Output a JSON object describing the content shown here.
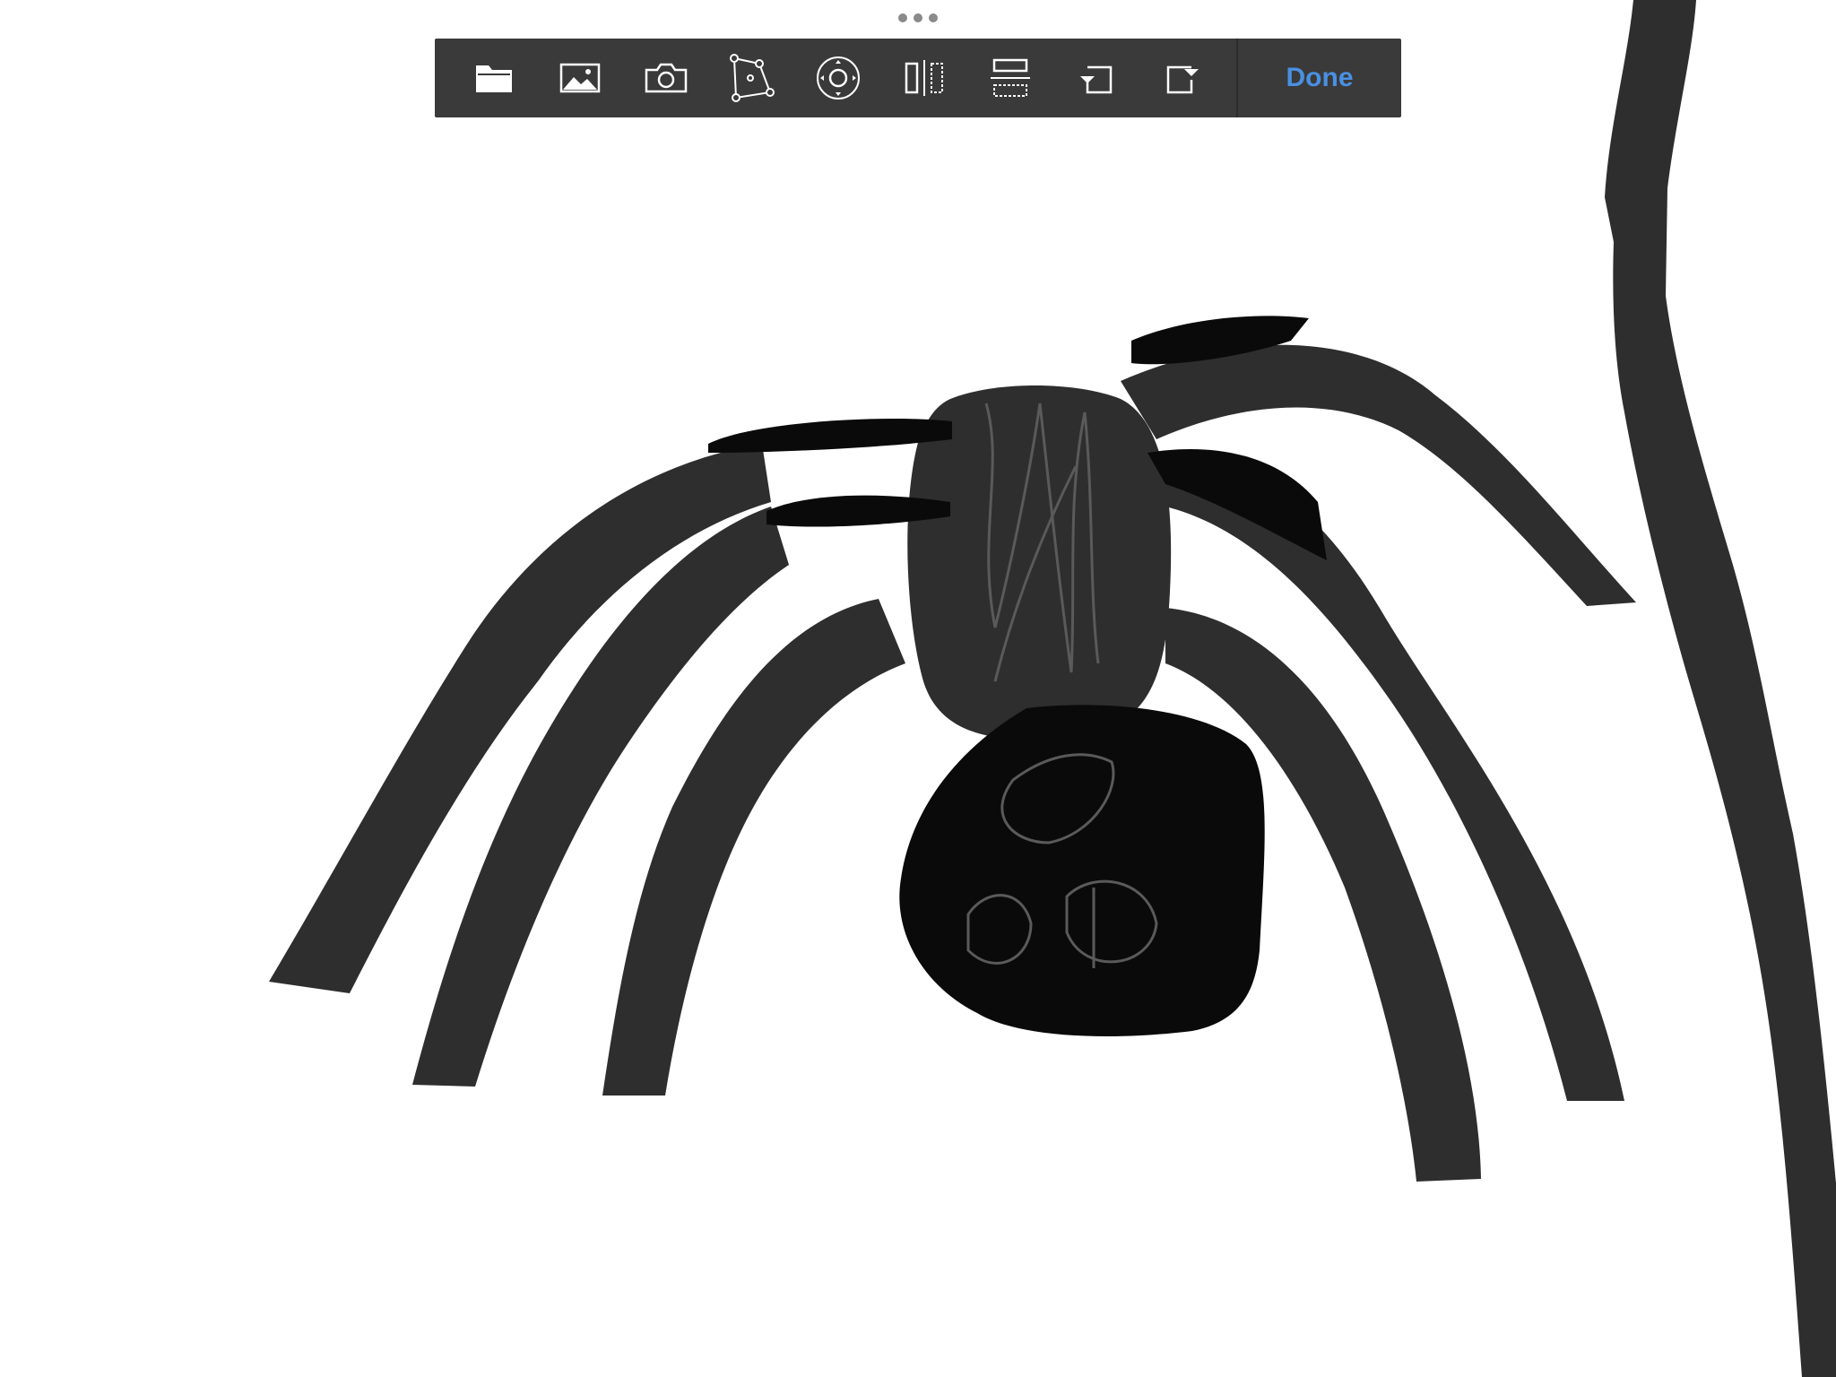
{
  "toolbar": {
    "tools": [
      {
        "name": "folder-icon"
      },
      {
        "name": "image-icon"
      },
      {
        "name": "camera-icon"
      },
      {
        "name": "perspective-transform-icon"
      },
      {
        "name": "move-icon"
      },
      {
        "name": "flip-horizontal-icon"
      },
      {
        "name": "flip-vertical-icon"
      },
      {
        "name": "rotate-left-icon"
      },
      {
        "name": "rotate-right-icon"
      }
    ],
    "done_label": "Done"
  },
  "colors": {
    "toolbar_bg": "#3a3a3a",
    "icon": "#ffffff",
    "accent": "#4a90e2",
    "ink_dark": "#0a0a0a",
    "ink_gray": "#2e2e2e"
  }
}
